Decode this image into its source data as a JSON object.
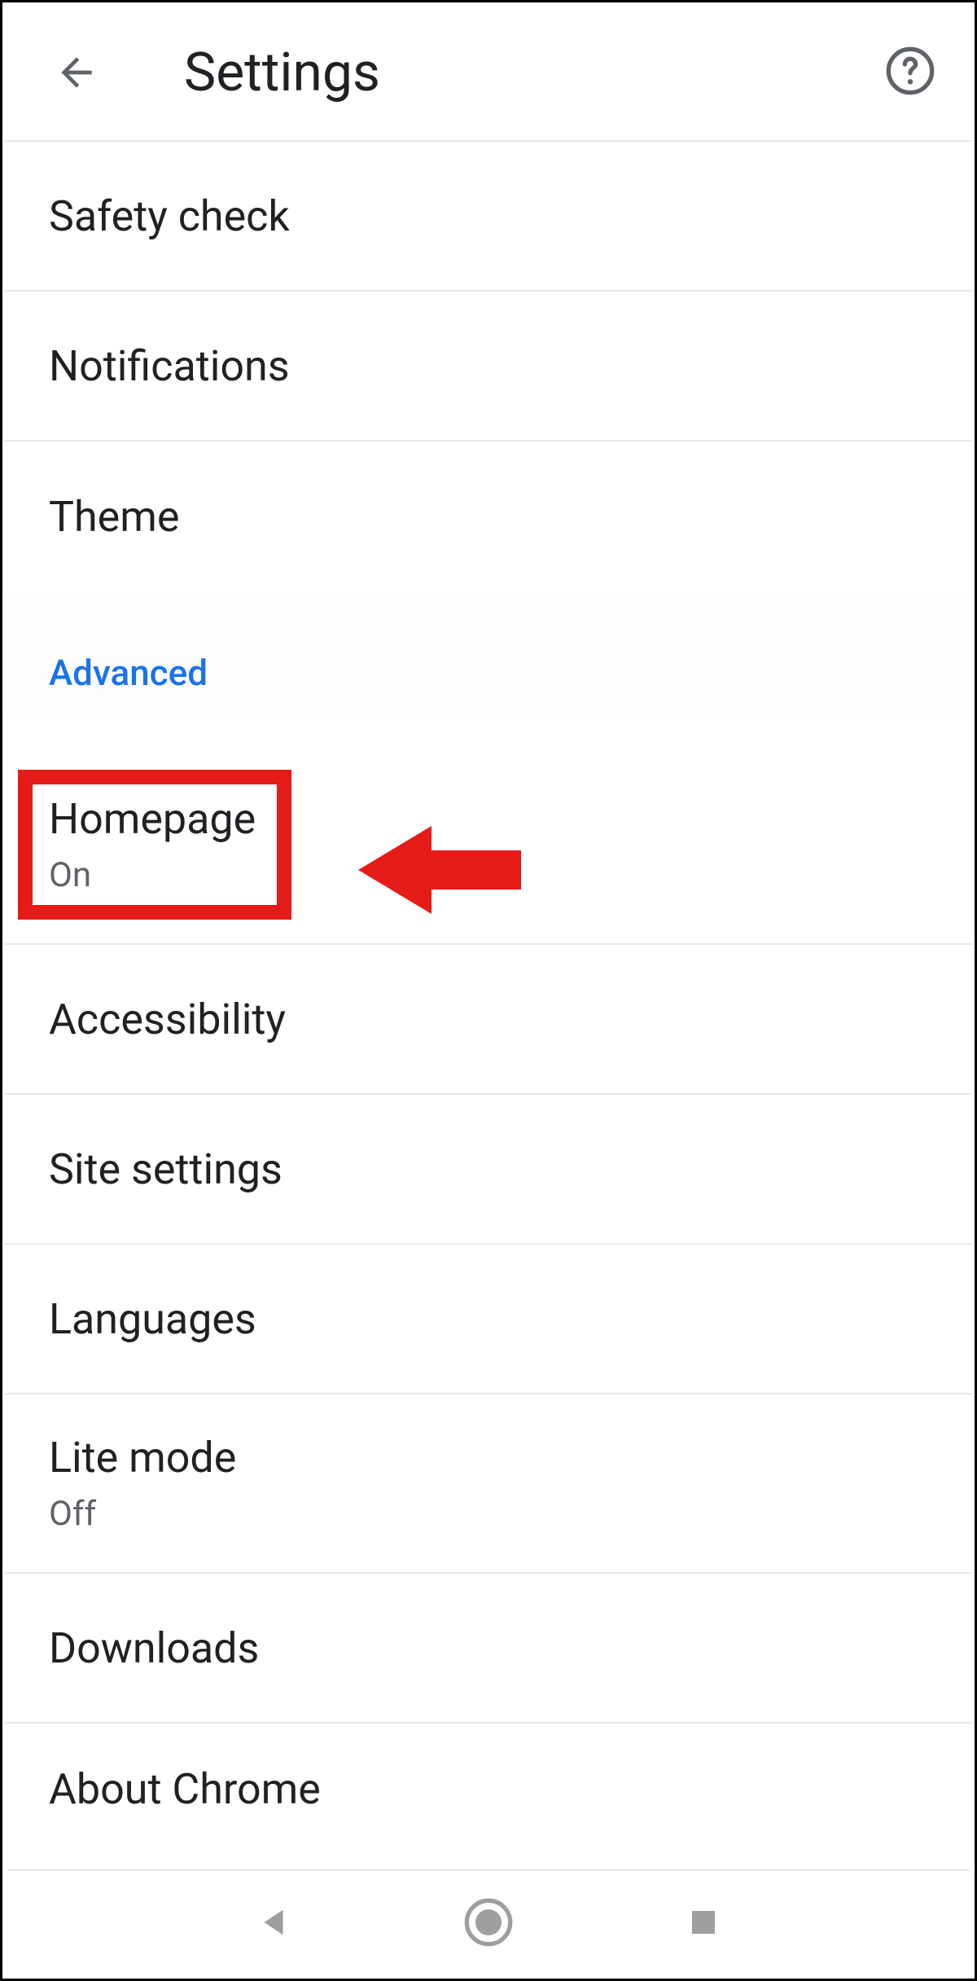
{
  "header": {
    "title": "Settings"
  },
  "items": {
    "safety_check": "Safety check",
    "notifications": "Notifications",
    "theme": "Theme",
    "advanced_label": "Advanced",
    "homepage": "Homepage",
    "homepage_state": "On",
    "accessibility": "Accessibility",
    "site_settings": "Site settings",
    "languages": "Languages",
    "lite_mode": "Lite mode",
    "lite_mode_state": "Off",
    "downloads": "Downloads",
    "about_chrome": "About Chrome"
  },
  "annotation": {
    "highlight_color": "#e41b17"
  }
}
